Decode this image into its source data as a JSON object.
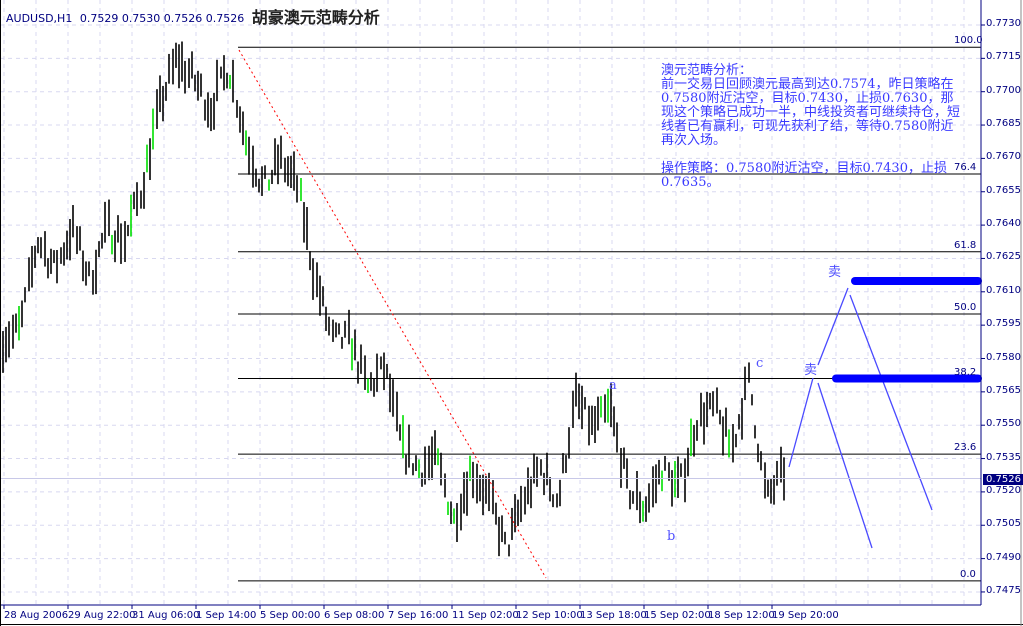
{
  "header": {
    "symbol": "AUDUSD,H1",
    "ohlc": "0.7529 0.7530 0.7526 0.7526",
    "title": "胡豪澳元范畴分析"
  },
  "note": {
    "text": "澳元范畴分析：\n前一交易日回顾澳元最高到达0.7574，昨日策略在0.7580附近沽空，目标0.7430，止损0.7630，那现这个策略已成功一半，中线投资者可继续持仓，短线者已有赢利，可现先获利了结，等待0.7580附近再次入场。\n\n操作策略：0.7580附近沽空，目标0.7430，止损0.7635。"
  },
  "colors": {
    "axis": "#000080",
    "grid": "#d8d8f0",
    "bars": "#000000",
    "green_bars": "#00e000",
    "fib": "#000000",
    "trend": "#ff0000",
    "projection": "#4a4aff",
    "target": "#0000ff",
    "current": "#000080"
  },
  "chart_data": {
    "type": "ohlc",
    "symbol": "AUDUSD",
    "timeframe": "H1",
    "ylim": [
      0.7467,
      0.774
    ],
    "y_ticks": [
      "0.7730",
      "0.7715",
      "0.7700",
      "0.7685",
      "0.7670",
      "0.7655",
      "0.7640",
      "0.7625",
      "0.7610",
      "0.7595",
      "0.7580",
      "0.7565",
      "0.7550",
      "0.7535",
      "0.7520",
      "0.7505",
      "0.7490",
      "0.7475"
    ],
    "x_ticks": [
      "28 Aug 2006",
      "29 Aug 22:00",
      "31 Aug 06:00",
      "1 Sep 14:00",
      "5 Sep 00:00",
      "6 Sep 08:00",
      "7 Sep 16:00",
      "11 Sep 02:00",
      "12 Sep 10:00",
      "13 Sep 18:00",
      "15 Sep 02:00",
      "18 Sep 12:00",
      "19 Sep 20:00"
    ],
    "current_price": "0.7526",
    "price_path": [
      0.7588,
      0.7593,
      0.7633,
      0.762,
      0.7638,
      0.7615,
      0.7638,
      0.7633,
      0.7656,
      0.7692,
      0.7714,
      0.7705,
      0.7692,
      0.7712,
      0.7678,
      0.7656,
      0.7669,
      0.7656,
      0.7615,
      0.7588,
      0.7588,
      0.7566,
      0.7575,
      0.7539,
      0.753,
      0.7534,
      0.7507,
      0.753,
      0.7516,
      0.7494,
      0.7516,
      0.753,
      0.7516,
      0.7561,
      0.7548,
      0.7557,
      0.7521,
      0.7512,
      0.753,
      0.7521,
      0.7552,
      0.7557,
      0.7539,
      0.757,
      0.7516,
      0.7528
    ],
    "fibonacci": [
      {
        "level": "100.0",
        "price": 0.772
      },
      {
        "level": "76.4",
        "price": 0.7663
      },
      {
        "level": "61.8",
        "price": 0.7628
      },
      {
        "level": "50.0",
        "price": 0.76
      },
      {
        "level": "38.2",
        "price": 0.7571
      },
      {
        "level": "23.6",
        "price": 0.7537
      },
      {
        "level": "0.0",
        "price": 0.748
      }
    ],
    "wave_labels": [
      "a",
      "b",
      "c"
    ],
    "sell_labels": [
      "卖",
      "卖"
    ]
  }
}
